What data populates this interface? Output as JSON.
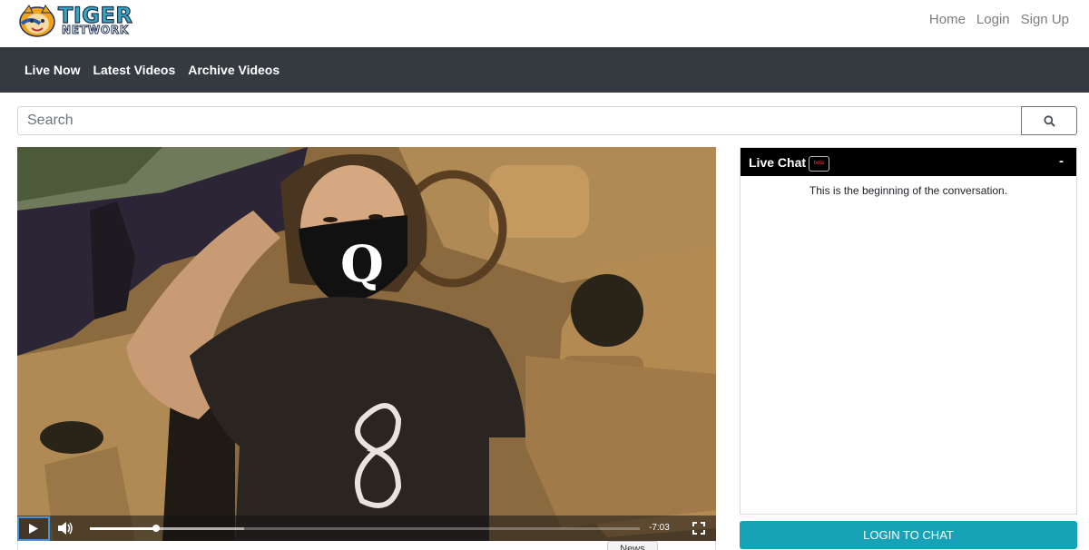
{
  "brand": {
    "line1": "TIGER",
    "line2": "NETWORK"
  },
  "top_links": [
    "Home",
    "Login",
    "Sign Up"
  ],
  "nav": [
    "Live Now",
    "Latest Videos",
    "Archive Videos"
  ],
  "search": {
    "placeholder": "Search",
    "icon": "search-icon"
  },
  "player": {
    "time_remaining": "-7:03",
    "progress_fraction": 0.12,
    "buffered_fraction": 0.28,
    "controls": [
      "play-icon",
      "volume-icon",
      "fullscreen-icon"
    ]
  },
  "below_video_tab": "News",
  "chat": {
    "title": "Live Chat",
    "badge": "beta",
    "minimize": "-",
    "empty_message": "This is the beginning of the conversation.",
    "login_button": "LOGIN TO CHAT"
  },
  "colors": {
    "nav_bg": "#343a40",
    "accent": "#17a2b8",
    "brand_teal": "#3aa7c0"
  }
}
